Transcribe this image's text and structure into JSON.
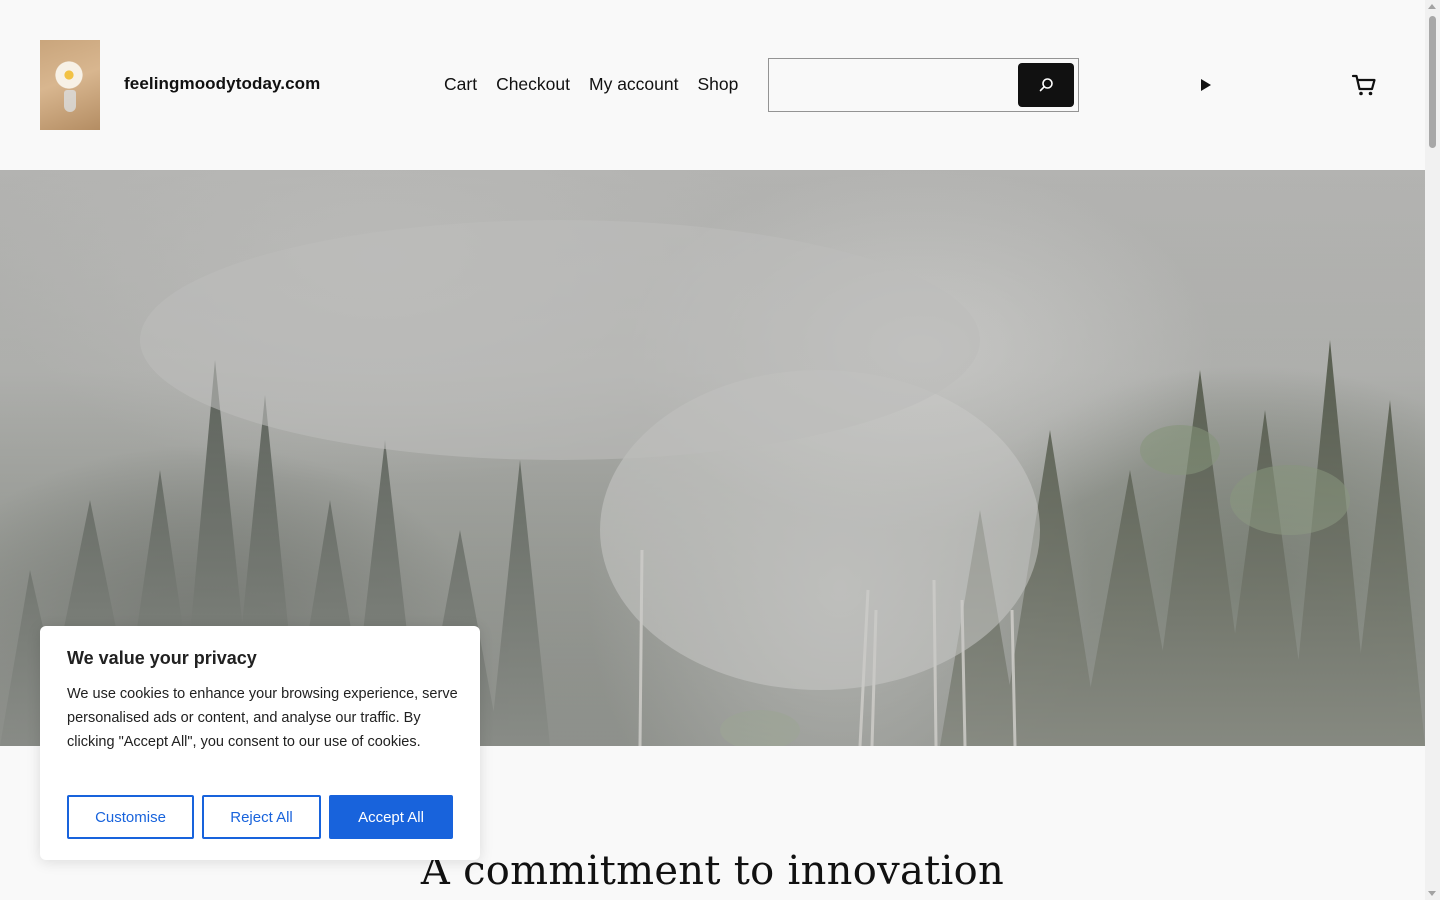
{
  "site": {
    "title": "feelingmoodytoday.com"
  },
  "nav": {
    "items": [
      {
        "label": "Cart"
      },
      {
        "label": "Checkout"
      },
      {
        "label": "My account"
      },
      {
        "label": "Shop"
      }
    ]
  },
  "search": {
    "value": "",
    "icon": "search-icon"
  },
  "header_icons": {
    "play": "play-icon",
    "cart": "cart-icon"
  },
  "hero": {
    "image": "misty-forest"
  },
  "content": {
    "headline": "A commitment to innovation"
  },
  "cookie_banner": {
    "title": "We value your privacy",
    "body": "We use cookies to enhance your browsing experience, serve personalised ads or content, and analyse our traffic. By clicking \"Accept All\", you consent to our use of cookies.",
    "customise_label": "Customise",
    "reject_label": "Reject All",
    "accept_label": "Accept All"
  },
  "colors": {
    "accent": "#1863dc",
    "background": "#f9f9f9",
    "text": "#111111"
  }
}
